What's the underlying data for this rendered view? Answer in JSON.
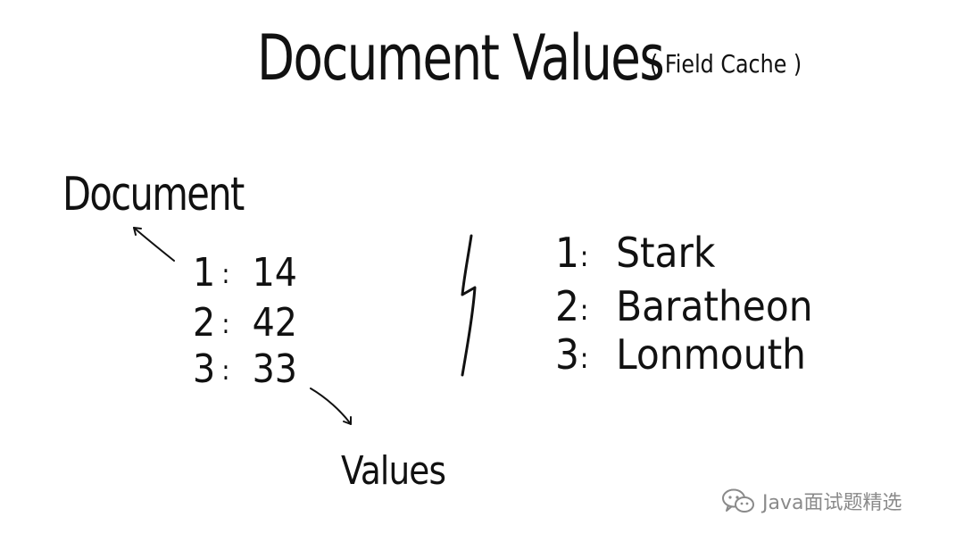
{
  "title": "Document Values",
  "subtitle": "( Field Cache )",
  "labels": {
    "document": "Document",
    "values": "Values"
  },
  "numeric_column": [
    {
      "doc": "1",
      "sep": ":",
      "value": "14"
    },
    {
      "doc": "2",
      "sep": ":",
      "value": "42"
    },
    {
      "doc": "3",
      "sep": ":",
      "value": "33"
    }
  ],
  "string_column": [
    {
      "doc": "1",
      "sep": ":",
      "value": "Stark"
    },
    {
      "doc": "2",
      "sep": ":",
      "value": "Baratheon"
    },
    {
      "doc": "3",
      "sep": ":",
      "value": "Lonmouth"
    }
  ],
  "watermark": {
    "text": "Java面试题精选",
    "icon": "wechat-icon"
  }
}
